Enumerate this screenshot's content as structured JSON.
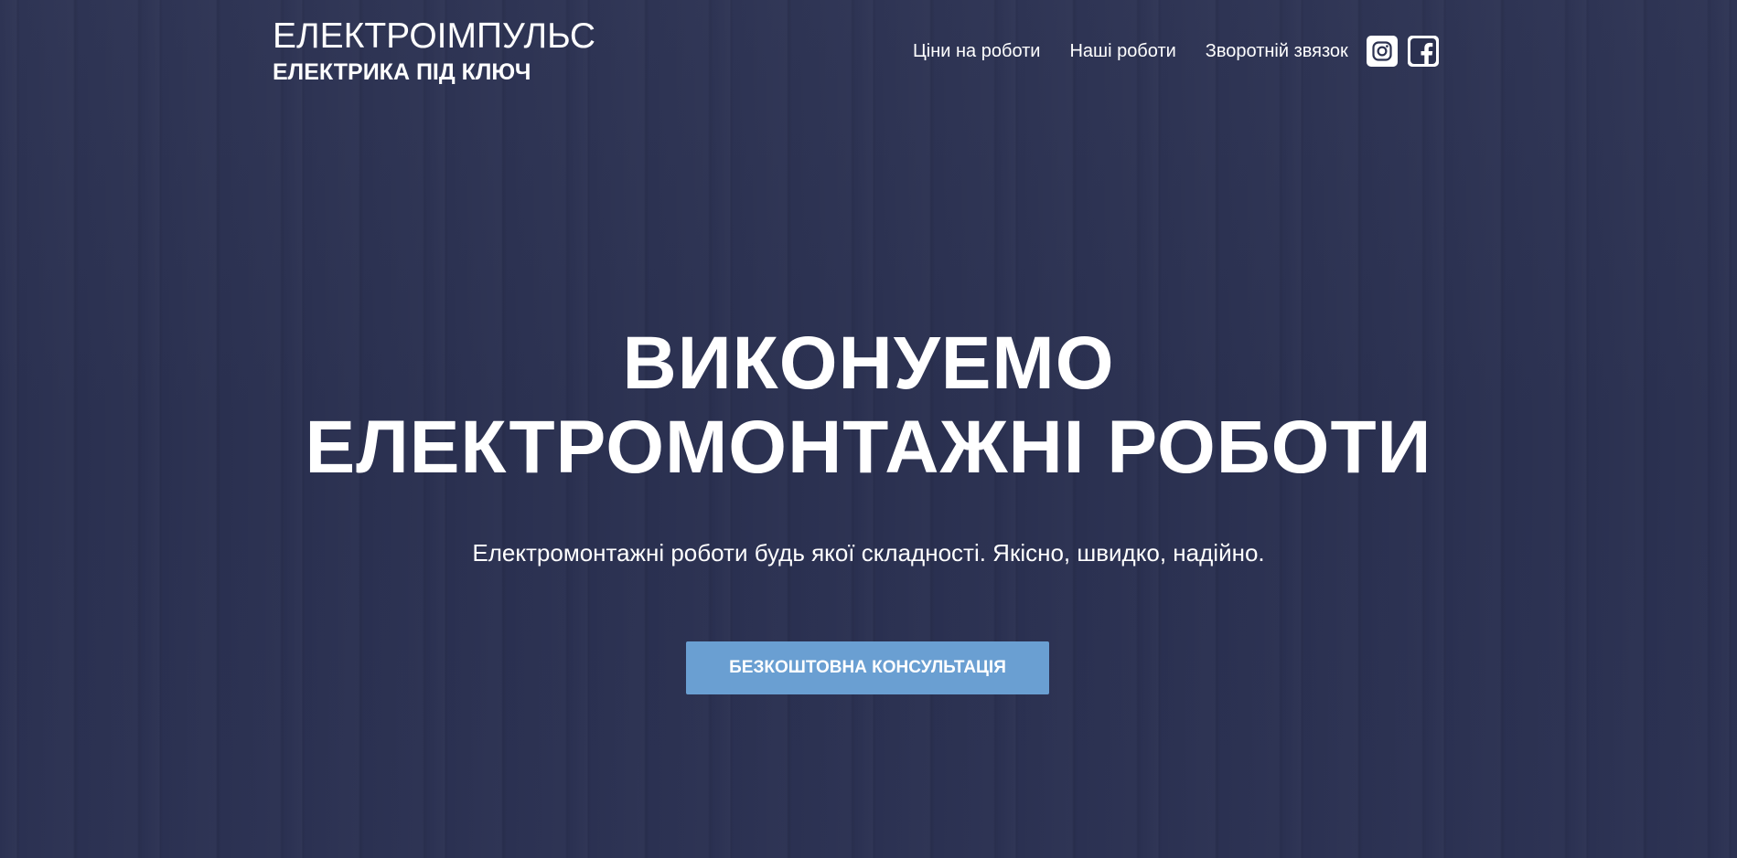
{
  "brand": {
    "title": "ЕЛЕКТРОІМПУЛЬС",
    "subtitle": "ЕЛЕКТРИКА ПІД КЛЮЧ"
  },
  "nav": {
    "items": [
      {
        "label": "Ціни на роботи"
      },
      {
        "label": "Наші роботи"
      },
      {
        "label": "Зворотній звязок"
      }
    ],
    "social": [
      {
        "icon": "instagram-icon"
      },
      {
        "icon": "facebook-icon"
      }
    ]
  },
  "hero": {
    "headline_line1": "ВИКОНУЕМО",
    "headline_line2": "ЕЛЕКТРОМОНТАЖНІ РОБОТИ",
    "subtitle": "Електромонтажні роботи будь якої складності. Якісно, швидко, надійно.",
    "cta_label": "БЕЗКОШТОВНА КОНСУЛЬТАЦІЯ"
  },
  "colors": {
    "background": "#2b3150",
    "cta": "#6a9fd2",
    "text": "#ffffff"
  }
}
